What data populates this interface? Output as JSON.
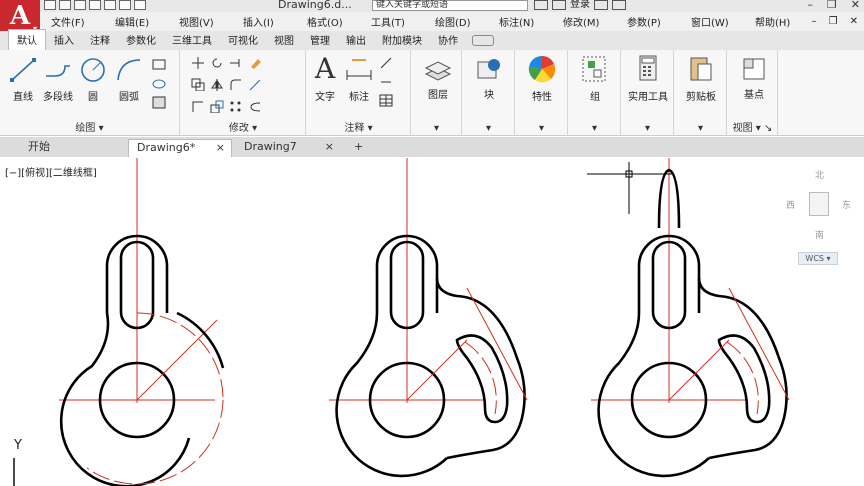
{
  "app": {
    "logo_letter": "A",
    "document_title": "Drawing6.d...",
    "search_placeholder": "键入关键字或短语",
    "login_label": "登录"
  },
  "menu": {
    "items": [
      "文件(F)",
      "编辑(E)",
      "视图(V)",
      "插入(I)",
      "格式(O)",
      "工具(T)",
      "绘图(D)",
      "标注(N)",
      "修改(M)",
      "参数(P)",
      "窗口(W)",
      "帮助(H)"
    ]
  },
  "ribbon_tabs": [
    "默认",
    "插入",
    "注释",
    "参数化",
    "三维工具",
    "可视化",
    "视图",
    "管理",
    "输出",
    "附加模块",
    "协作"
  ],
  "ribbon": {
    "draw": {
      "line": "直线",
      "polyline": "多段线",
      "circle": "圆",
      "arc": "圆弧",
      "title": "绘图"
    },
    "modify": {
      "title": "修改"
    },
    "annotation": {
      "text": "文字",
      "dimension": "标注",
      "title": "注释"
    },
    "layers": {
      "label": "图层"
    },
    "block": {
      "label": "块"
    },
    "properties": {
      "label": "特性"
    },
    "groups": {
      "label": "组"
    },
    "utilities": {
      "label": "实用工具"
    },
    "clipboard": {
      "label": "剪贴板"
    },
    "view": {
      "base": "基点",
      "title": "视图"
    }
  },
  "file_tabs": {
    "start": "开始",
    "drawing6": "Drawing6*",
    "drawing7": "Drawing7",
    "close": "×",
    "add": "+"
  },
  "viewport": {
    "label": "[−][俯视][二维线框]"
  },
  "viewcube": {
    "north": "北",
    "south": "南",
    "east": "东",
    "west": "西",
    "wcs": "WCS"
  },
  "ucs": {
    "y_label": "Y"
  },
  "colors": {
    "accent_red": "#c8282e",
    "centerline": "#d03020",
    "outline": "#000000"
  }
}
